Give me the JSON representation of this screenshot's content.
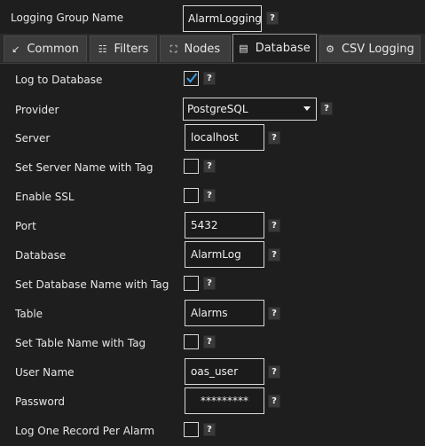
{
  "header": {
    "group_name_label": "Logging Group Name",
    "group_name_value": "AlarmLogging",
    "help": "?"
  },
  "tabs": [
    {
      "label": "Common",
      "icon": "arrow-icon"
    },
    {
      "label": "Filters",
      "icon": "list-icon"
    },
    {
      "label": "Nodes",
      "icon": "nodes-icon"
    },
    {
      "label": "Database",
      "icon": "database-icon",
      "active": true
    },
    {
      "label": "CSV Logging",
      "icon": "gear-icon"
    }
  ],
  "form": {
    "log_to_database": {
      "label": "Log to Database",
      "checked": true
    },
    "provider": {
      "label": "Provider",
      "value": "PostgreSQL"
    },
    "server": {
      "label": "Server",
      "value": "localhost"
    },
    "server_tag": {
      "label": "Set Server Name with Tag",
      "checked": false
    },
    "ssl": {
      "label": "Enable SSL",
      "checked": false
    },
    "port": {
      "label": "Port",
      "value": "5432"
    },
    "database": {
      "label": "Database",
      "value": "AlarmLog"
    },
    "database_tag": {
      "label": "Set Database Name with Tag",
      "checked": false
    },
    "table": {
      "label": "Table",
      "value": "Alarms"
    },
    "table_tag": {
      "label": "Set Table Name with Tag",
      "checked": false
    },
    "user": {
      "label": "User Name",
      "value": "oas_user"
    },
    "password": {
      "label": "Password",
      "value": "*********"
    },
    "one_record": {
      "label": "Log One Record Per Alarm",
      "checked": false
    }
  },
  "help": "?",
  "colors": {
    "check": "#3b9be0",
    "background": "#1e1e1e",
    "field_border": "#d8d8d8"
  }
}
